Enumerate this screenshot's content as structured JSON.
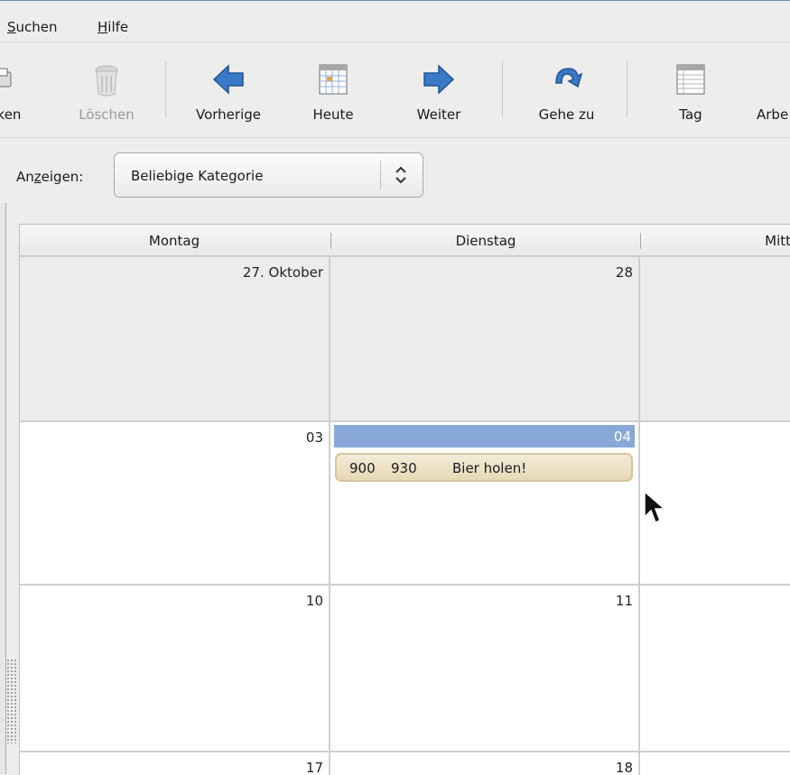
{
  "menu": {
    "suchen": {
      "mnemonic": "S",
      "rest": "uchen"
    },
    "hilfe": {
      "mnemonic": "H",
      "rest": "ilfe"
    }
  },
  "toolbar": {
    "drucken_partial": "ken",
    "loeschen": "Löschen",
    "vorherige": "Vorherige",
    "heute": "Heute",
    "weiter": "Weiter",
    "gehe_zu": "Gehe zu",
    "tag": "Tag",
    "arbeitswoche_partial": "Arbe"
  },
  "filter": {
    "label_pre": "An",
    "label_mnemonic": "z",
    "label_post": "eigen:",
    "selected": "Beliebige Kategorie"
  },
  "calendar": {
    "columns": [
      "Montag",
      "Dienstag",
      "Mitt"
    ],
    "weeks": [
      {
        "days": [
          "27. Oktober",
          "28",
          ""
        ]
      },
      {
        "days": [
          "03",
          "04",
          ""
        ]
      },
      {
        "days": [
          "10",
          "11",
          ""
        ]
      },
      {
        "days": [
          "17",
          "18",
          ""
        ]
      }
    ],
    "event": {
      "start": "900",
      "end": "930",
      "title": "Bier holen!"
    }
  },
  "colors": {
    "today_highlight": "#88a9d8",
    "event_background": "#e7d8b8",
    "arrow_blue": "#3a78c8"
  }
}
